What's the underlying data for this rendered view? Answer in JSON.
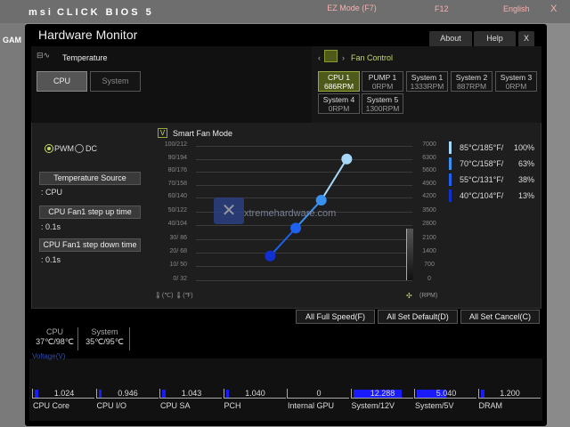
{
  "header": {
    "logo": "msi",
    "product": "CLICK BIOS 5",
    "ez_mode": "EZ Mode (F7)",
    "f12": "F12",
    "language": "English",
    "close": "X",
    "bg_tab": "GAM"
  },
  "window": {
    "title": "Hardware Monitor",
    "about": "About",
    "help": "Help",
    "close": "X"
  },
  "temperature": {
    "label": "Temperature",
    "tabs": [
      "CPU",
      "System"
    ]
  },
  "fan_control": {
    "label": "Fan Control",
    "fans": [
      {
        "name": "CPU 1",
        "rpm": "686RPM",
        "selected": true
      },
      {
        "name": "PUMP 1",
        "rpm": "0RPM"
      },
      {
        "name": "System 1",
        "rpm": "1333RPM"
      },
      {
        "name": "System 2",
        "rpm": "887RPM"
      },
      {
        "name": "System 3",
        "rpm": "0RPM"
      },
      {
        "name": "System 4",
        "rpm": "0RPM"
      },
      {
        "name": "System 5",
        "rpm": "1300RPM"
      }
    ]
  },
  "mode": {
    "pwm": "PWM",
    "dc": "DC",
    "selected": "PWM"
  },
  "settings": [
    {
      "label": "Temperature Source",
      "value": ": CPU"
    },
    {
      "label": "CPU Fan1 step up time",
      "value": ": 0.1s"
    },
    {
      "label": "CPU Fan1 step down time",
      "value": ": 0.1s"
    }
  ],
  "smart_fan": {
    "label": "Smart Fan Mode",
    "checked": true,
    "check_glyph": "V"
  },
  "chart_data": {
    "type": "line",
    "left_ticks": [
      "100/212",
      "90/194",
      "80/176",
      "70/158",
      "60/140",
      "50/122",
      "40/104",
      "30/ 86",
      "20/ 68",
      "10/ 50",
      "0/ 32"
    ],
    "right_ticks": [
      "7000",
      "6300",
      "5600",
      "4900",
      "4200",
      "3500",
      "2800",
      "2100",
      "1400",
      "700",
      "0"
    ],
    "left_unit_c": "(℃)",
    "left_unit_f": "(℉)",
    "right_unit": "(RPM)",
    "points": [
      {
        "temp_c": 40,
        "temp_f": 104,
        "percent": 13,
        "color": "#1030d0"
      },
      {
        "temp_c": 55,
        "temp_f": 131,
        "percent": 38,
        "color": "#1e60f0"
      },
      {
        "temp_c": 70,
        "temp_f": 158,
        "percent": 63,
        "color": "#3a90f0"
      },
      {
        "temp_c": 85,
        "temp_f": 185,
        "percent": 100,
        "color": "#a8d8f8"
      }
    ],
    "legend": [
      {
        "label": "85°C/185°F/",
        "value": "100%",
        "color": "#a8d8f8"
      },
      {
        "label": "70°C/158°F/",
        "value": "63%",
        "color": "#3a90f0"
      },
      {
        "label": "55°C/131°F/",
        "value": "38%",
        "color": "#1e60f0"
      },
      {
        "label": "40°C/104°F/",
        "value": "13%",
        "color": "#1030d0"
      }
    ]
  },
  "watermark": "xtremehardware.com",
  "actions": {
    "full_speed": "All Full Speed(F)",
    "set_default": "All Set Default(D)",
    "set_cancel": "All Set Cancel(C)"
  },
  "readings": [
    {
      "label": "CPU",
      "value": "37℃/98℃"
    },
    {
      "label": "System",
      "value": "35℃/95℃"
    }
  ],
  "voltage": {
    "label": "Voltage(V)",
    "items": [
      {
        "name": "CPU Core",
        "value": "1.024",
        "fill": 0.06
      },
      {
        "name": "CPU I/O",
        "value": "0.946",
        "fill": 0.05
      },
      {
        "name": "CPU SA",
        "value": "1.043",
        "fill": 0.06
      },
      {
        "name": "PCH",
        "value": "1.040",
        "fill": 0.06
      },
      {
        "name": "Internal GPU",
        "value": "0",
        "fill": 0
      },
      {
        "name": "System/12V",
        "value": "12.288",
        "fill": 0.82
      },
      {
        "name": "System/5V",
        "value": "5.040",
        "fill": 0.5
      },
      {
        "name": "DRAM",
        "value": "1.200",
        "fill": 0.07
      }
    ]
  }
}
